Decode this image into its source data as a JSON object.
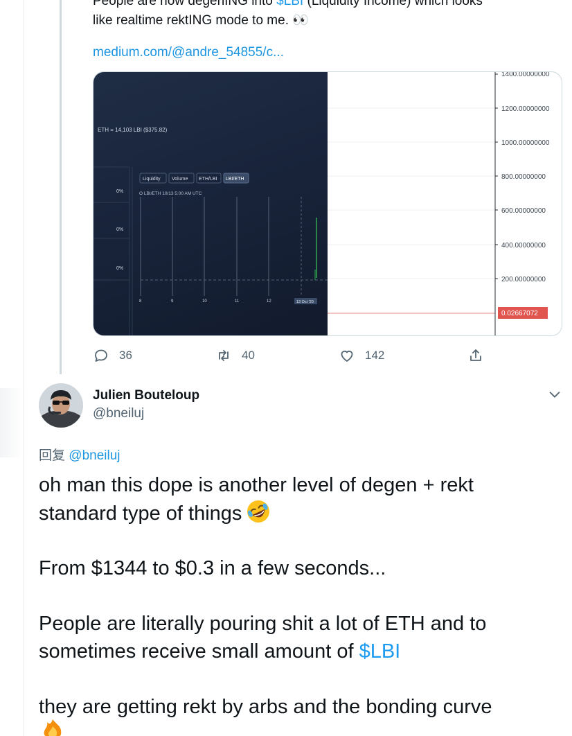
{
  "quoted_tweet": {
    "text_line1_a": "People are now degenING into ",
    "text_line1_cash": "$LBI",
    "text_line1_b": " (Liquidity Income) which looks",
    "text_line2": "like realtime rektING mode to me. 👀",
    "link": "medium.com/@andre_54855/c..."
  },
  "media": {
    "eth_label": "ETH = 14,103 LBI ($375.82)",
    "tabs": [
      "Liquidity",
      "Volume",
      "ETH/LBI",
      "LBI/ETH"
    ],
    "ohlc_label": "O  LBI/ETH  10/13  5:00 AM UTC",
    "percent_labels": [
      "0%",
      "0%",
      "0%"
    ],
    "x_ticks": [
      "9",
      "10",
      "11",
      "12"
    ],
    "date_tag": "13 Oct '20",
    "y_ticks": [
      "1400.00000000",
      "1200.00000000",
      "1000.00000000",
      "800.00000000",
      "600.00000000",
      "400.00000000",
      "200.00000000"
    ],
    "price_tag": "0.02667072",
    "price_tag_color": "#e0554e"
  },
  "actions": {
    "replies": "36",
    "retweets": "40",
    "likes": "142"
  },
  "reply_tweet": {
    "name": "Julien Bouteloup",
    "handle": "@bneiluj",
    "reply_prefix": "回复 ",
    "reply_mention": "@bneiluj",
    "line1": "oh man this dope is another level of degen + rekt",
    "line2": "standard type of things",
    "line3": "From $1344 to $0.3 in a few seconds...",
    "line4": "People are literally pouring shit a lot of ETH and to",
    "line5_a": "sometimes receive small amount of ",
    "line5_cash": "$LBI",
    "line6": "they are getting rekt by arbs and the bonding curve"
  },
  "colors": {
    "link": "#1b95e0",
    "cashtag": "#1d9bf0",
    "secondary_text": "#536471",
    "chart_up": "#2fa84f"
  }
}
